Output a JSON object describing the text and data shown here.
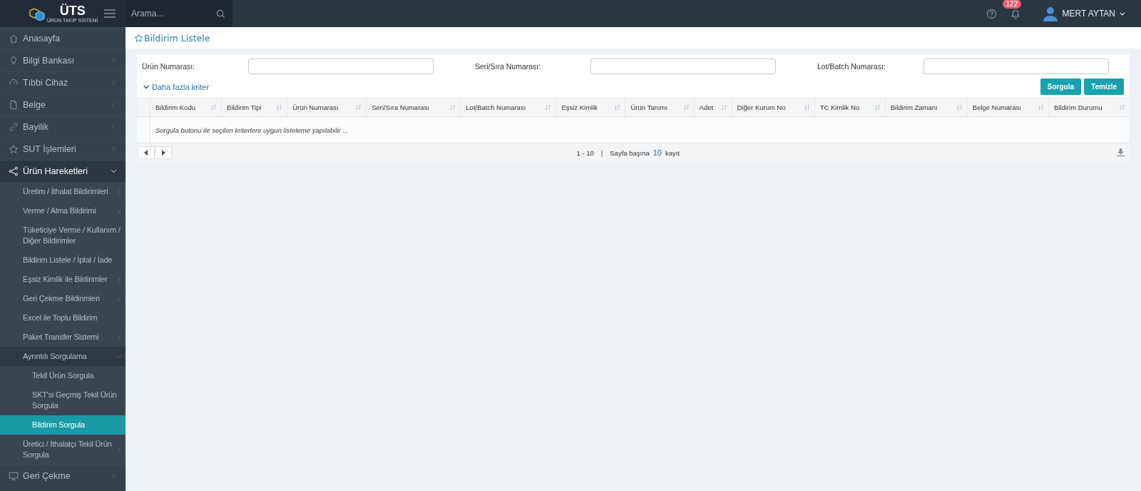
{
  "logo": {
    "text": "ÜTS",
    "subtitle": "ÜRÜN TAKİP SİSTEMİ"
  },
  "search": {
    "placeholder": "Arama..."
  },
  "topbar": {
    "notification_count": "122",
    "user_name": "MERT AYTAN"
  },
  "sidebar": {
    "items": [
      {
        "label": "Anasayfa",
        "kind": "link",
        "selected": false
      },
      {
        "label": "Bilgi Bankası",
        "kind": "menu",
        "expanded": false,
        "selected": false
      },
      {
        "label": "Tıbbi Cihaz",
        "kind": "menu",
        "expanded": false,
        "selected": false
      },
      {
        "label": "Belge",
        "kind": "menu",
        "expanded": false,
        "selected": false
      },
      {
        "label": "Bayilik",
        "kind": "menu",
        "expanded": false,
        "selected": false
      },
      {
        "label": "SUT İşlemleri",
        "kind": "menu",
        "expanded": false,
        "selected": false
      },
      {
        "label": "Ürün Hareketleri",
        "kind": "menu",
        "expanded": true,
        "selected": false,
        "children": [
          {
            "label": "Üretim / İthalat Bildirimleri",
            "kind": "menu",
            "expanded": false,
            "selected": false
          },
          {
            "label": "Verme / Alma Bildirimi",
            "kind": "menu",
            "expanded": false,
            "selected": false
          },
          {
            "label": "Tüketiciye Verme / Kullanım / Diğer Bildirimler",
            "kind": "link",
            "selected": false
          },
          {
            "label": "Bildirim Listele / İptal / İade",
            "kind": "link",
            "selected": false
          },
          {
            "label": "Eşsiz Kimlik ile Bildirimler",
            "kind": "menu",
            "expanded": false,
            "selected": false
          },
          {
            "label": "Geri Çekme Bildirimleri",
            "kind": "menu",
            "expanded": false,
            "selected": false
          },
          {
            "label": "Excel ile Toplu Bildirim",
            "kind": "link",
            "selected": false
          },
          {
            "label": "Paket Transfer Sistemi",
            "kind": "menu",
            "expanded": false,
            "selected": false
          },
          {
            "label": "Ayrıntılı Sorgulama",
            "kind": "menu",
            "expanded": true,
            "selected": false,
            "children": [
              {
                "label": "Tekil Ürün Sorgula",
                "selected": false
              },
              {
                "label": "SKT'si Geçmiş Tekil Ürün Sorgula",
                "selected": false
              },
              {
                "label": "Bildirim Sorgula",
                "selected": true
              }
            ]
          },
          {
            "label": "Üretici / İthalatçı Tekil Ürün Sorgula",
            "kind": "menu",
            "expanded": false,
            "selected": false
          }
        ]
      },
      {
        "label": "Geri Çekme",
        "kind": "menu",
        "expanded": false,
        "selected": false
      }
    ]
  },
  "page": {
    "title": "Bildirim Listele"
  },
  "filters": [
    {
      "label": "Ürün Numarası:"
    },
    {
      "label": "Seri/Sıra Numarası:"
    },
    {
      "label": "Lot/Batch Numarası:"
    }
  ],
  "more_criteria": "Daha fazla kriter",
  "buttons": [
    "Sorgula",
    "Temizle"
  ],
  "table": {
    "columns": [
      "Bildirim Kodu",
      "Bildirim Tipi",
      "Ürün Numarası",
      "Seri/Sıra Numarası",
      "Lot/Batch Numarası",
      "Eşsiz Kimlik",
      "Ürün Tanımı",
      "Adet",
      "Diğer Kurum No",
      "TC Kimlik No",
      "Bildirim Zamanı",
      "Belge Numarası",
      "Bildirim Durumu"
    ],
    "empty_message": "Sorgula butonu ile seçilen kriterlere uygun listeleme yapılabilir ..."
  },
  "pager": {
    "range": "1 - 10",
    "separator": "|",
    "per_page_label": "Sayfa başına",
    "per_page": "10",
    "unit": "kayıt"
  }
}
